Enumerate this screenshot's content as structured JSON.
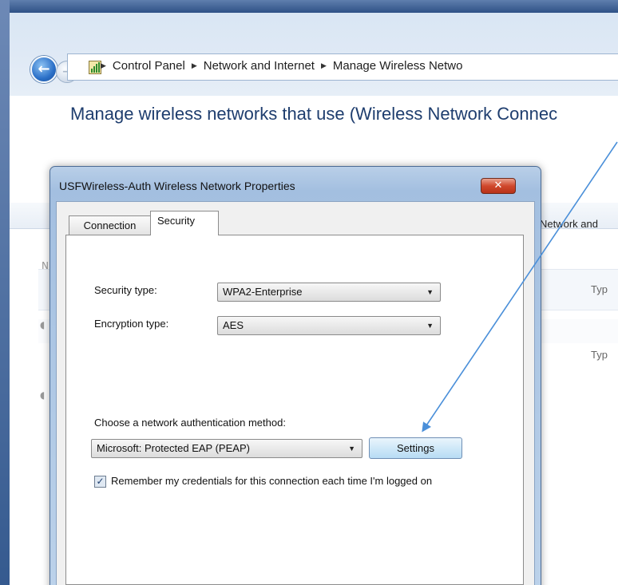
{
  "window": {
    "breadcrumbs": [
      "Control Panel",
      "Network and Internet",
      "Manage Wireless Netwo"
    ],
    "page_title": "Manage wireless networks that use (Wireless Network Connec",
    "toolbar_partial": "Network and",
    "list_type_1": "Typ",
    "list_type_2": "Typ"
  },
  "dialog": {
    "title": "USFWireless-Auth Wireless Network Properties",
    "close_glyph": "✕",
    "tabs": [
      {
        "label": "Connection",
        "selected": false
      },
      {
        "label": "Security",
        "selected": true
      }
    ],
    "security_type": {
      "label": "Security type:",
      "value": "WPA2-Enterprise"
    },
    "encryption_type": {
      "label": "Encryption type:",
      "value": "AES"
    },
    "auth_method": {
      "label": "Choose a network authentication method:",
      "value": "Microsoft: Protected EAP (PEAP)"
    },
    "settings_button": "Settings",
    "remember_credentials": {
      "checked": true,
      "text": "Remember my credentials for this connection each time I'm logged on"
    }
  },
  "icons": {
    "back": "back-arrow-icon",
    "forward": "forward-arrow-icon",
    "network": "network-folder-icon",
    "close": "close-icon",
    "dropdown": "chevron-down-icon"
  },
  "colors": {
    "annotation_arrow": "#4a8fd9",
    "title_text": "#1e3d6e",
    "close_button": "#c8432a"
  }
}
